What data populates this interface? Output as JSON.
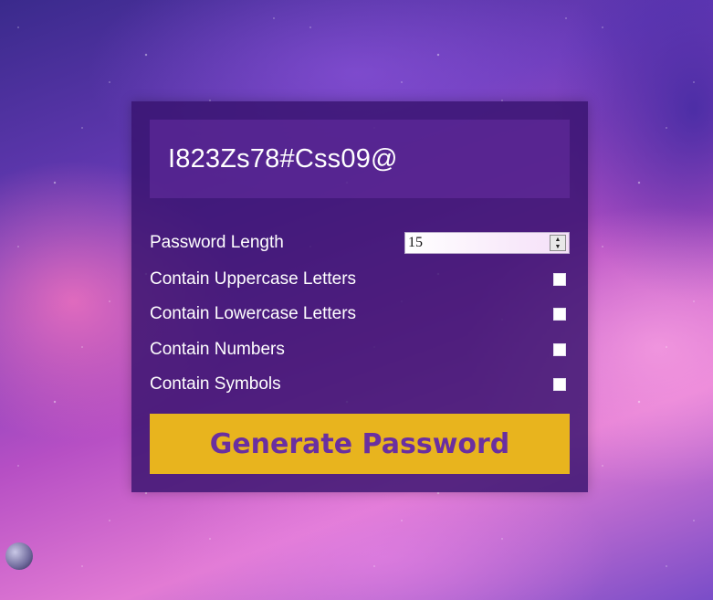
{
  "password_output": "I823Zs78#Css09@",
  "settings": {
    "length": {
      "label": "Password Length",
      "value": "15"
    },
    "uppercase": {
      "label": "Contain Uppercase Letters"
    },
    "lowercase": {
      "label": "Contain Lowercase Letters"
    },
    "numbers": {
      "label": "Contain Numbers"
    },
    "symbols": {
      "label": "Contain Symbols"
    }
  },
  "generate_button_label": "Generate Password",
  "colors": {
    "card_background": "#37126e",
    "button_background": "#e8b41e",
    "button_text": "#6a2fa0"
  }
}
